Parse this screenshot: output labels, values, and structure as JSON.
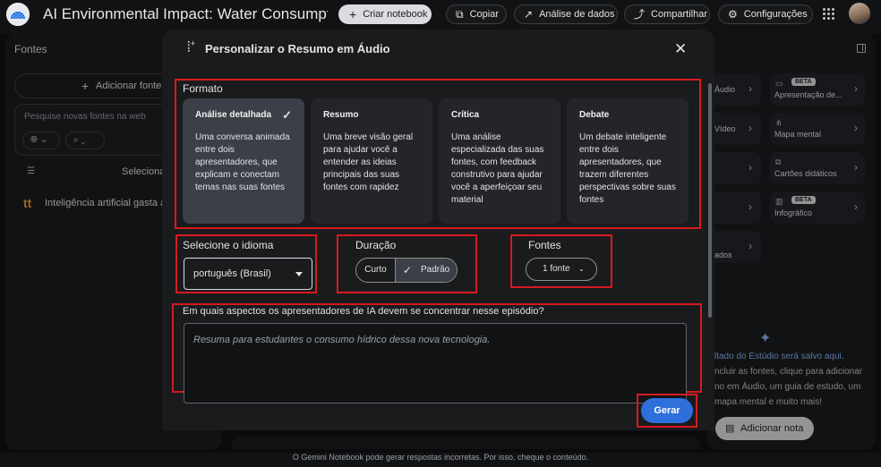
{
  "topbar": {
    "title": "AI Environmental Impact: Water Consumption a",
    "create_notebook": "Criar notebook",
    "copy": "Copiar",
    "data_analysis": "Análise de dados",
    "share": "Compartilhar",
    "settings": "Configurações"
  },
  "sources_panel": {
    "title": "Fontes",
    "add_sources": "Adicionar fontes",
    "search_placeholder": "Pesquise novas fontes na web",
    "select_all_label": "Selecionar",
    "items": [
      {
        "name": "Inteligência artificial gasta águ",
        "icon": "tt"
      }
    ]
  },
  "studio_panel": {
    "tiles": [
      {
        "label": "Áudio",
        "column": "a"
      },
      {
        "label": "Apresentação de...",
        "column": "b",
        "badge": "BETA"
      },
      {
        "label": "Vídeo",
        "column": "a"
      },
      {
        "label": "Mapa mental",
        "column": "b"
      },
      {
        "label": "",
        "column": "a"
      },
      {
        "label": "Cartões didáticos",
        "column": "b"
      },
      {
        "label": "",
        "column": "a"
      },
      {
        "label": "Infográfico",
        "column": "b",
        "badge": "BETA"
      },
      {
        "label": "ados",
        "column": "a"
      }
    ],
    "message_highlight": "ltado do Estúdio será salvo aqui.",
    "message_lines": [
      "ncluir as fontes, clique para adicionar",
      "no em Áudio, um guia de estudo, um",
      "mapa mental e muito mais!"
    ],
    "add_note": "Adicionar nota"
  },
  "disclaimer": "O Gemini Notebook pode gerar respostas incorretas. Por isso, cheque o conteúdo.",
  "modal": {
    "title": "Personalizar o Resumo em Áudio",
    "format_label": "Formato",
    "formats": [
      {
        "title": "Análise detalhada",
        "selected": true,
        "desc": "Uma conversa animada entre dois apresentadores, que explicam e conectam temas nas suas fontes"
      },
      {
        "title": "Resumo",
        "selected": false,
        "desc": "Uma breve visão geral para ajudar você a entender as ideias principais das suas fontes com rapidez"
      },
      {
        "title": "Crítica",
        "selected": false,
        "desc": "Uma análise especializada das suas fontes, com feedback construtivo para ajudar você a aperfeiçoar seu material"
      },
      {
        "title": "Debate",
        "selected": false,
        "desc": "Um debate inteligente entre dois apresentadores, que trazem diferentes perspectivas sobre suas fontes"
      }
    ],
    "language_label": "Selecione o idioma",
    "language_value": "português (Brasil)",
    "duration_label": "Duração",
    "duration_options": [
      "Curto",
      "Padrão"
    ],
    "duration_selected": "Padrão",
    "sources_label": "Fontes",
    "sources_value": "1 fonte",
    "prompt_label": "Em quais aspectos os apresentadores de IA devem se concentrar nesse episódio?",
    "prompt_placeholder": "Resuma para estudantes o consumo hídrico dessa nova tecnologia.",
    "generate": "Gerar"
  },
  "colors": {
    "highlight_border": "#d71a1f",
    "primary_button": "#2f6fdc",
    "link_blue": "#8ab4f8",
    "background": "#111214"
  }
}
